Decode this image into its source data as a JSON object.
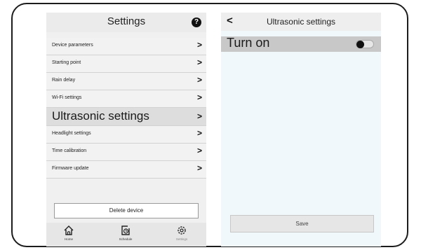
{
  "settings": {
    "title": "Settings",
    "help_icon": "?",
    "menu": [
      {
        "label": "Device parameters"
      },
      {
        "label": "Starting point"
      },
      {
        "label": "Rain delay"
      },
      {
        "label": "Wi-Fi settings"
      },
      {
        "label": "Ultrasonic settings"
      },
      {
        "label": "Headlight settings"
      },
      {
        "label": "Time calibration"
      },
      {
        "label": "Firmware update"
      }
    ],
    "chevron": ">",
    "delete_label": "Delete device",
    "nav": {
      "home": "Home",
      "schedule": "Schedule",
      "settings": "Settings"
    }
  },
  "ultrasonic": {
    "back_glyph": "<",
    "title": "Ultrasonic settings",
    "toggle_label": "Turn on",
    "toggle_state": "off",
    "save_label": "Save"
  }
}
